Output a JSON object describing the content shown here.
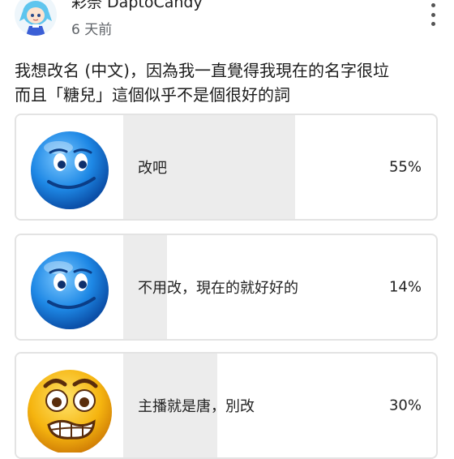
{
  "post": {
    "author": "彩奈 DaptoCandy",
    "time": "6 天前",
    "question_line1": "我想改名 (中文)，因為我一直覺得我現在的名字很垃",
    "question_line2": "而且「糖兒」這個似乎不是個很好的詞"
  },
  "poll": {
    "options": [
      {
        "label": "改吧",
        "percent_text": "55%",
        "percent": 55,
        "image": "smiling-blue-face-icon"
      },
      {
        "label": "不用改，現在的就好好的",
        "percent_text": "14%",
        "percent": 14,
        "image": "smiling-blue-face-icon"
      },
      {
        "label": "主播就是唐，別改",
        "percent_text": "30%",
        "percent": 30,
        "image": "nervous-grimacing-face-icon"
      }
    ]
  },
  "colors": {
    "bar_fill": "#ececec",
    "border": "#e3e3e3",
    "blue_face": "#1e88e5",
    "yellow_face": "#f5b40f"
  }
}
